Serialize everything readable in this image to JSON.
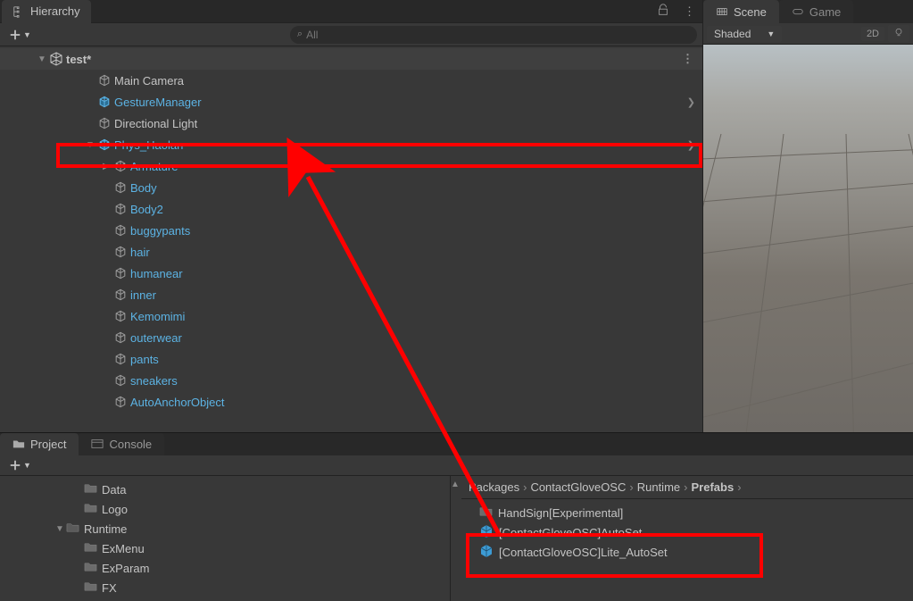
{
  "hierarchy": {
    "tab_label": "Hierarchy",
    "search_placeholder": "All",
    "scene_name": "test*",
    "items": [
      {
        "label": "Main Camera",
        "blue": false,
        "indent": 3,
        "icon": "cube-grey"
      },
      {
        "label": "GestureManager",
        "blue": true,
        "indent": 3,
        "icon": "cube-blue",
        "chev": true
      },
      {
        "label": "Directional Light",
        "blue": false,
        "indent": 3,
        "icon": "cube-grey"
      },
      {
        "label": "Phys_Haolan",
        "blue": true,
        "indent": 3,
        "icon": "cube-blue",
        "disclosure": "▼",
        "chev": true,
        "highlight": true
      },
      {
        "label": "Armature",
        "blue": true,
        "indent": 4,
        "icon": "cube-grey",
        "disclosure": "▶"
      },
      {
        "label": "Body",
        "blue": true,
        "indent": 4,
        "icon": "cube-grey"
      },
      {
        "label": "Body2",
        "blue": true,
        "indent": 4,
        "icon": "cube-grey"
      },
      {
        "label": "buggypants",
        "blue": true,
        "indent": 4,
        "icon": "cube-grey"
      },
      {
        "label": "hair",
        "blue": true,
        "indent": 4,
        "icon": "cube-grey"
      },
      {
        "label": "humanear",
        "blue": true,
        "indent": 4,
        "icon": "cube-grey"
      },
      {
        "label": "inner",
        "blue": true,
        "indent": 4,
        "icon": "cube-grey"
      },
      {
        "label": "Kemomimi",
        "blue": true,
        "indent": 4,
        "icon": "cube-grey"
      },
      {
        "label": "outerwear",
        "blue": true,
        "indent": 4,
        "icon": "cube-grey"
      },
      {
        "label": "pants",
        "blue": true,
        "indent": 4,
        "icon": "cube-grey"
      },
      {
        "label": "sneakers",
        "blue": true,
        "indent": 4,
        "icon": "cube-grey"
      },
      {
        "label": "AutoAnchorObject",
        "blue": true,
        "indent": 4,
        "icon": "cube-grey"
      }
    ]
  },
  "scene": {
    "tabs": {
      "scene": "Scene",
      "game": "Game"
    },
    "shaded_label": "Shaded",
    "btn_2d": "2D"
  },
  "project": {
    "tab_project": "Project",
    "tab_console": "Console",
    "folders": [
      {
        "label": "Data",
        "indent": 3
      },
      {
        "label": "Logo",
        "indent": 3
      },
      {
        "label": "Runtime",
        "indent": 2,
        "disclosure": "▼",
        "open": true
      },
      {
        "label": "ExMenu",
        "indent": 3
      },
      {
        "label": "ExParam",
        "indent": 3
      },
      {
        "label": "FX",
        "indent": 3
      }
    ],
    "breadcrumb": [
      "Packages",
      "ContactGloveOSC",
      "Runtime",
      "Prefabs"
    ],
    "assets": [
      {
        "label": "HandSign[Experimental]",
        "type": "folder"
      },
      {
        "label": "[ContactGloveOSC]AutoSet",
        "type": "prefab"
      },
      {
        "label": "[ContactGloveOSC]Lite_AutoSet",
        "type": "prefab"
      }
    ]
  }
}
